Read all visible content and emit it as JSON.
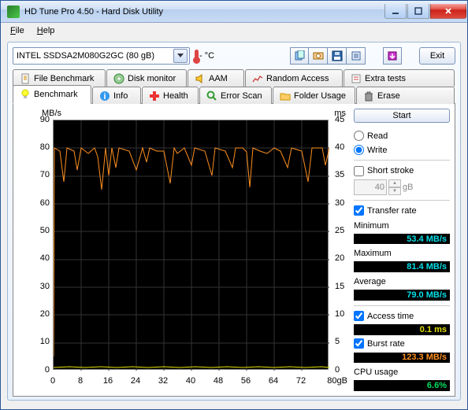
{
  "window": {
    "title": "HD Tune Pro 4.50 - Hard Disk Utility"
  },
  "menu": {
    "file": "File",
    "help": "Help"
  },
  "toolbar": {
    "drive": "INTEL SSDSA2M080G2GC (80 gB)",
    "temp": "- °C",
    "exit": "Exit"
  },
  "tabs2": [
    {
      "icon": "page",
      "label": "File Benchmark"
    },
    {
      "icon": "disk",
      "label": "Disk monitor"
    },
    {
      "icon": "speaker",
      "label": "AAM"
    },
    {
      "icon": "random",
      "label": "Random Access"
    },
    {
      "icon": "tests",
      "label": "Extra tests"
    }
  ],
  "tabs1": [
    {
      "icon": "bulb",
      "label": "Benchmark"
    },
    {
      "icon": "info",
      "label": "Info"
    },
    {
      "icon": "health",
      "label": "Health"
    },
    {
      "icon": "scan",
      "label": "Error Scan"
    },
    {
      "icon": "folder",
      "label": "Folder Usage"
    },
    {
      "icon": "erase",
      "label": "Erase"
    }
  ],
  "chart": {
    "y_left_label": "MB/s",
    "y_right_label": "ms",
    "yl_ticks": [
      "90",
      "80",
      "70",
      "60",
      "50",
      "40",
      "30",
      "20",
      "10",
      "0"
    ],
    "yr_ticks": [
      "45",
      "40",
      "35",
      "30",
      "25",
      "20",
      "15",
      "10",
      "5",
      "0"
    ],
    "x_ticks": [
      "0",
      "8",
      "16",
      "24",
      "32",
      "40",
      "48",
      "56",
      "64",
      "72"
    ],
    "x_unit": "80gB"
  },
  "chart_data": {
    "type": "line",
    "title": "INTEL SSDSA2M080G2GC Write Benchmark",
    "xlabel": "gB",
    "ylabel_left": "MB/s",
    "ylabel_right": "ms",
    "x_range": [
      0,
      80
    ],
    "yl_range": [
      0,
      90
    ],
    "yr_range": [
      0,
      45
    ],
    "series": [
      {
        "name": "Transfer rate",
        "axis": "left",
        "unit": "MB/s",
        "color": "#ff9020",
        "summary": {
          "minimum": 53.4,
          "maximum": 81.4,
          "average": 79.0
        },
        "approx_points": [
          [
            0,
            5
          ],
          [
            0.2,
            80
          ],
          [
            2,
            79
          ],
          [
            3,
            68
          ],
          [
            4,
            80
          ],
          [
            6,
            79
          ],
          [
            7,
            72
          ],
          [
            8,
            80
          ],
          [
            10,
            78
          ],
          [
            12,
            80
          ],
          [
            14,
            65
          ],
          [
            15,
            80
          ],
          [
            16,
            70
          ],
          [
            17,
            80
          ],
          [
            18,
            73
          ],
          [
            19,
            80
          ],
          [
            22,
            79
          ],
          [
            24,
            72
          ],
          [
            26,
            80
          ],
          [
            27,
            75
          ],
          [
            28,
            80
          ],
          [
            30,
            79
          ],
          [
            32,
            79
          ],
          [
            34,
            67
          ],
          [
            35,
            80
          ],
          [
            36,
            78
          ],
          [
            38,
            80
          ],
          [
            40,
            74
          ],
          [
            41,
            80
          ],
          [
            44,
            79
          ],
          [
            46,
            70
          ],
          [
            47,
            80
          ],
          [
            50,
            79
          ],
          [
            52,
            73
          ],
          [
            53,
            80
          ],
          [
            55,
            80
          ],
          [
            57,
            66
          ],
          [
            58,
            80
          ],
          [
            60,
            79
          ],
          [
            62,
            78
          ],
          [
            64,
            80
          ],
          [
            66,
            79
          ],
          [
            68,
            73
          ],
          [
            69,
            80
          ],
          [
            72,
            79
          ],
          [
            74,
            68
          ],
          [
            75,
            80
          ],
          [
            78,
            80
          ],
          [
            79,
            74
          ],
          [
            80,
            80
          ]
        ]
      },
      {
        "name": "Access time",
        "axis": "right",
        "unit": "ms",
        "color": "#e0e000",
        "summary": {
          "average": 0.1
        },
        "approx_points": [
          [
            0,
            0.1
          ],
          [
            80,
            0.1
          ]
        ]
      }
    ],
    "burst_rate": {
      "value": 123.3,
      "unit": "MB/s"
    },
    "cpu_usage": {
      "value": 6.6,
      "unit": "%"
    }
  },
  "side": {
    "start": "Start",
    "read": "Read",
    "write": "Write",
    "mode": "write",
    "short_stroke": "Short stroke",
    "short_val": "40",
    "gb": "gB",
    "transfer_rate": "Transfer rate",
    "min_l": "Minimum",
    "min_v": "53.4 MB/s",
    "max_l": "Maximum",
    "max_v": "81.4 MB/s",
    "avg_l": "Average",
    "avg_v": "79.0 MB/s",
    "acc_l": "Access time",
    "acc_v": "0.1 ms",
    "burst_l": "Burst rate",
    "burst_v": "123.3 MB/s",
    "cpu_l": "CPU usage",
    "cpu_v": "6.6%"
  }
}
